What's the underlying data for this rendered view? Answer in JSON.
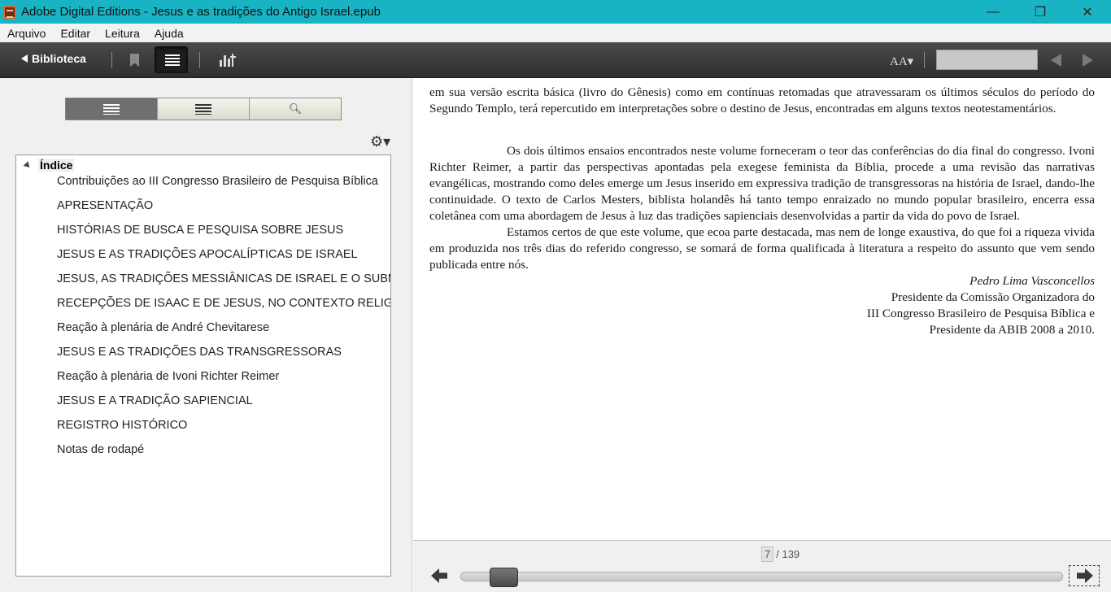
{
  "window": {
    "title": "Adobe Digital Editions - Jesus e as tradições do Antigo Israel.epub",
    "minimize_glyph": "—",
    "maximize_glyph": "❐",
    "close_glyph": "✕"
  },
  "menubar": {
    "items": [
      "Arquivo",
      "Editar",
      "Leitura",
      "Ajuda"
    ]
  },
  "toolbar": {
    "library_label": "Biblioteca",
    "font_size_glyph": "AA▾",
    "search_value": ""
  },
  "sidebar": {
    "gear_glyph": "⚙▾",
    "toc_root": "Índice",
    "toc_items": [
      "Contribuições ao III Congresso Brasileiro de Pesquisa Bíblica",
      "APRESENTAÇÃO",
      "HISTÓRIAS DE BUSCA E PESQUISA SOBRE JESUS",
      "JESUS E AS TRADIÇÕES APOCALÍPTICAS DE ISRAEL",
      "JESUS, AS TRADIÇÕES MESSIÂNICAS DE ISRAEL E O SUBMUNI",
      "RECEPÇÕES DE ISAAC E DE JESUS, NO CONTEXTO RELIGIOSO",
      "Reação à plenária de André Chevitarese",
      "JESUS E AS TRADIÇÕES DAS TRANSGRESSORAS",
      "Reação à plenária de Ivoni Richter Reimer",
      "JESUS E A TRADIÇÃO SAPIENCIAL",
      "REGISTRO HISTÓRICO",
      "Notas de rodapé"
    ]
  },
  "reader": {
    "para1": "em sua versão escrita básica (livro do Gênesis) como em contínuas retomadas que atravessaram os últimos séculos do período do Segundo Templo, terá repercutido em interpretações sobre o destino de Jesus, encontradas em alguns textos neotesta­mentários.",
    "para2": "Os dois últimos ensaios encontrados neste volume forneceram o teor das conferências do dia final do congresso. Ivoni Richter Reimer, a partir das perspectivas apontadas pela exegese feminista da Bíblia, procede a uma revisão das narrativas evangélicas, mostrando como deles emerge um Jesus inserido em expressiva tradição de transgressoras na história de Israel, dando-lhe continuidade. O texto de Carlos Mesters, biblista holandês há tanto tempo enraizado no mundo popular brasileiro, encerra essa coletânea com uma abordagem de Jesus à luz das tradições sapienciais desenvolvidas a partir da vida do povo de Israel.",
    "para3": "Estamos certos de que este volume, que ecoa parte destacada, mas nem de longe exaustiva, do que foi a riqueza vivida em produzida nos três dias do referido congresso, se somará de forma qualificada à literatura a respeito do assunto que vem sendo publicada entre nós.",
    "signature_name": "Pedro Lima Vasconcellos",
    "signature_lines": [
      "Presidente da Comissão Organizadora do",
      "III Congresso Brasileiro de Pesquisa Bíblica e",
      "Presidente da ABIB 2008 a 2010."
    ]
  },
  "footer": {
    "current_page": "7",
    "total_pages": "/ 139",
    "progress_fraction": 0.05
  }
}
